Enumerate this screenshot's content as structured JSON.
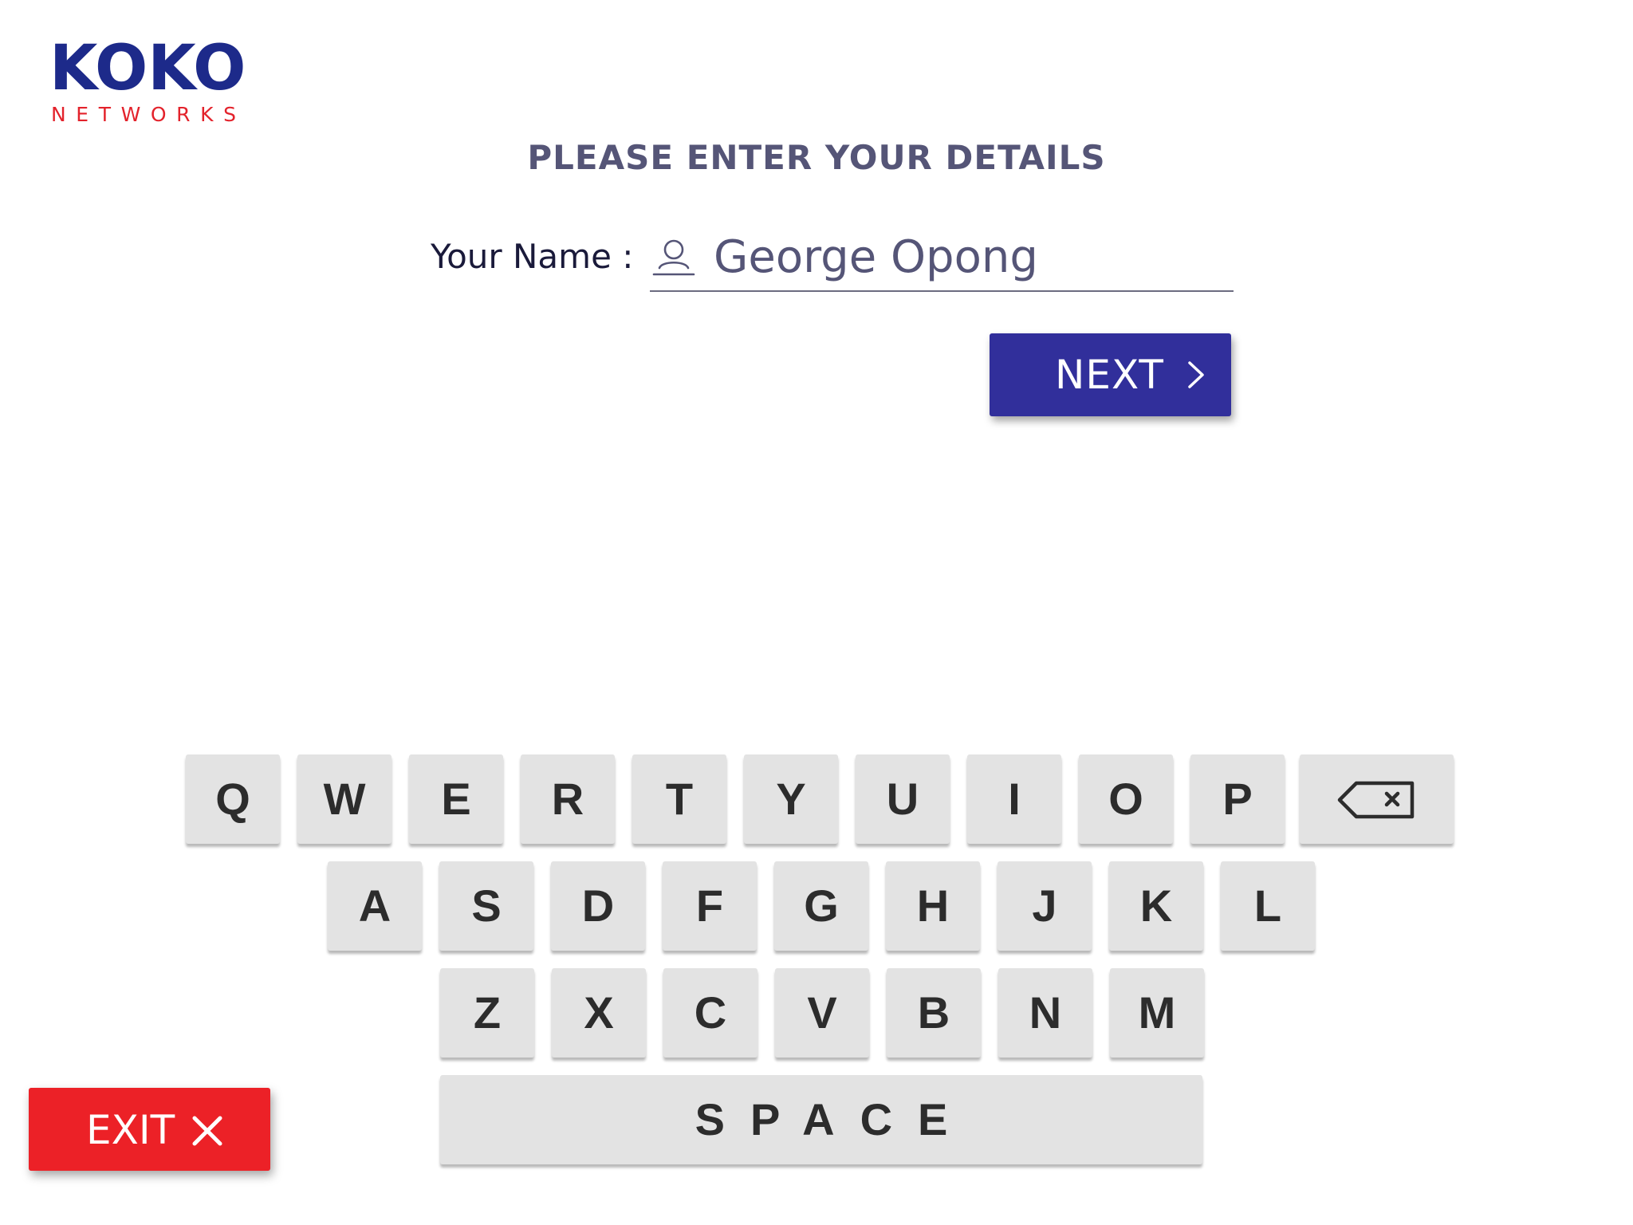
{
  "logo": {
    "top_text": "KOKO",
    "bottom_text": "NETWORKS",
    "colors": {
      "primary": "#1d2a8a",
      "accent": "#e3222b"
    }
  },
  "form": {
    "heading": "PLEASE ENTER YOUR DETAILS",
    "name_label": "Your Name :",
    "name_value": "George Opong",
    "name_icon": "user-icon"
  },
  "next_button": {
    "label": "NEXT",
    "icon": "chevron-right-icon",
    "color": "#312f9b"
  },
  "keyboard": {
    "rows": [
      [
        "Q",
        "W",
        "E",
        "R",
        "T",
        "Y",
        "U",
        "I",
        "O",
        "P"
      ],
      [
        "A",
        "S",
        "D",
        "F",
        "G",
        "H",
        "J",
        "K",
        "L"
      ],
      [
        "Z",
        "X",
        "C",
        "V",
        "B",
        "N",
        "M"
      ]
    ],
    "backspace_icon": "backspace-icon",
    "space_label": "SPACE"
  },
  "exit_button": {
    "label": "EXIT",
    "icon": "close-icon",
    "color": "#ec2127"
  }
}
